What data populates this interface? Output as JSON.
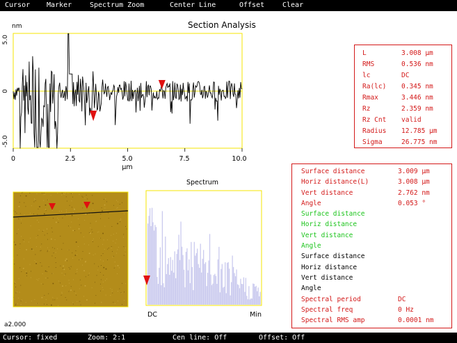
{
  "menu": [
    {
      "label": "Cursor"
    },
    {
      "label": "Marker"
    },
    {
      "label": "Spectrum Zoom"
    },
    {
      "label": "Center Line"
    },
    {
      "label": "Offset"
    },
    {
      "label": "Clear"
    }
  ],
  "title": "Section Analysis",
  "profile_plot": {
    "y_unit": "nm",
    "x_unit": "µm",
    "x_ticks": [
      "0",
      "2.5",
      "5.0",
      "7.5",
      "10.0"
    ],
    "y_ticks": [
      "5.0",
      "0",
      "-5.0"
    ],
    "xlim": [
      0,
      10
    ],
    "ylim": [
      -5,
      5
    ],
    "markers_x_um": [
      3.5,
      6.5
    ],
    "colors": {
      "frame": "#f5e600",
      "center_line": "#f5e600",
      "trace": "#000000",
      "marker": "#e01010"
    }
  },
  "roughness": [
    {
      "label": "L",
      "value": "3.008 µm"
    },
    {
      "label": "RMS",
      "value": "0.536 nm"
    },
    {
      "label": "lc",
      "value": "DC"
    },
    {
      "label": "Ra(lc)",
      "value": "0.345 nm"
    },
    {
      "label": "Rmax",
      "value": "3.446 nm"
    },
    {
      "label": "Rz",
      "value": "2.359 nm"
    },
    {
      "label": "Rz Cnt",
      "value": "valid"
    },
    {
      "label": "Radius",
      "value": "12.785 µm"
    },
    {
      "label": "Sigma",
      "value": "26.775 nm"
    }
  ],
  "spectrum": {
    "title": "Spectrum",
    "x_left": "DC",
    "x_right": "Min",
    "bar_color": "#c9c9ee"
  },
  "image": {
    "label": "a2.000",
    "colors": {
      "background": "#b38c1a",
      "frame": "#f5e600"
    }
  },
  "distances": [
    {
      "label": "Surface distance",
      "value": "3.009 µm",
      "color": "red"
    },
    {
      "label": "Horiz distance(L)",
      "value": "3.008 µm",
      "color": "red"
    },
    {
      "label": "Vert distance",
      "value": "2.762 nm",
      "color": "red"
    },
    {
      "label": "Angle",
      "value": "0.053 °",
      "color": "red"
    },
    {
      "label": "Surface distance",
      "value": "",
      "color": "green"
    },
    {
      "label": "Horiz distance",
      "value": "",
      "color": "green"
    },
    {
      "label": "Vert distance",
      "value": "",
      "color": "green"
    },
    {
      "label": "Angle",
      "value": "",
      "color": "green"
    },
    {
      "label": "Surface distance",
      "value": "",
      "color": "black"
    },
    {
      "label": "Horiz distance",
      "value": "",
      "color": "black"
    },
    {
      "label": "Vert distance",
      "value": "",
      "color": "black"
    },
    {
      "label": "Angle",
      "value": "",
      "color": "black"
    },
    {
      "label": "Spectral period",
      "value": "DC",
      "color": "red"
    },
    {
      "label": "Spectral freq",
      "value": "0 Hz",
      "color": "red"
    },
    {
      "label": "Spectral RMS amp",
      "value": "0.0001 nm",
      "color": "red"
    }
  ],
  "status": {
    "cursor": "Cursor: fixed",
    "zoom": "Zoom: 2:1",
    "cen_line": "Cen line: Off",
    "offset": "Offset: Off"
  }
}
